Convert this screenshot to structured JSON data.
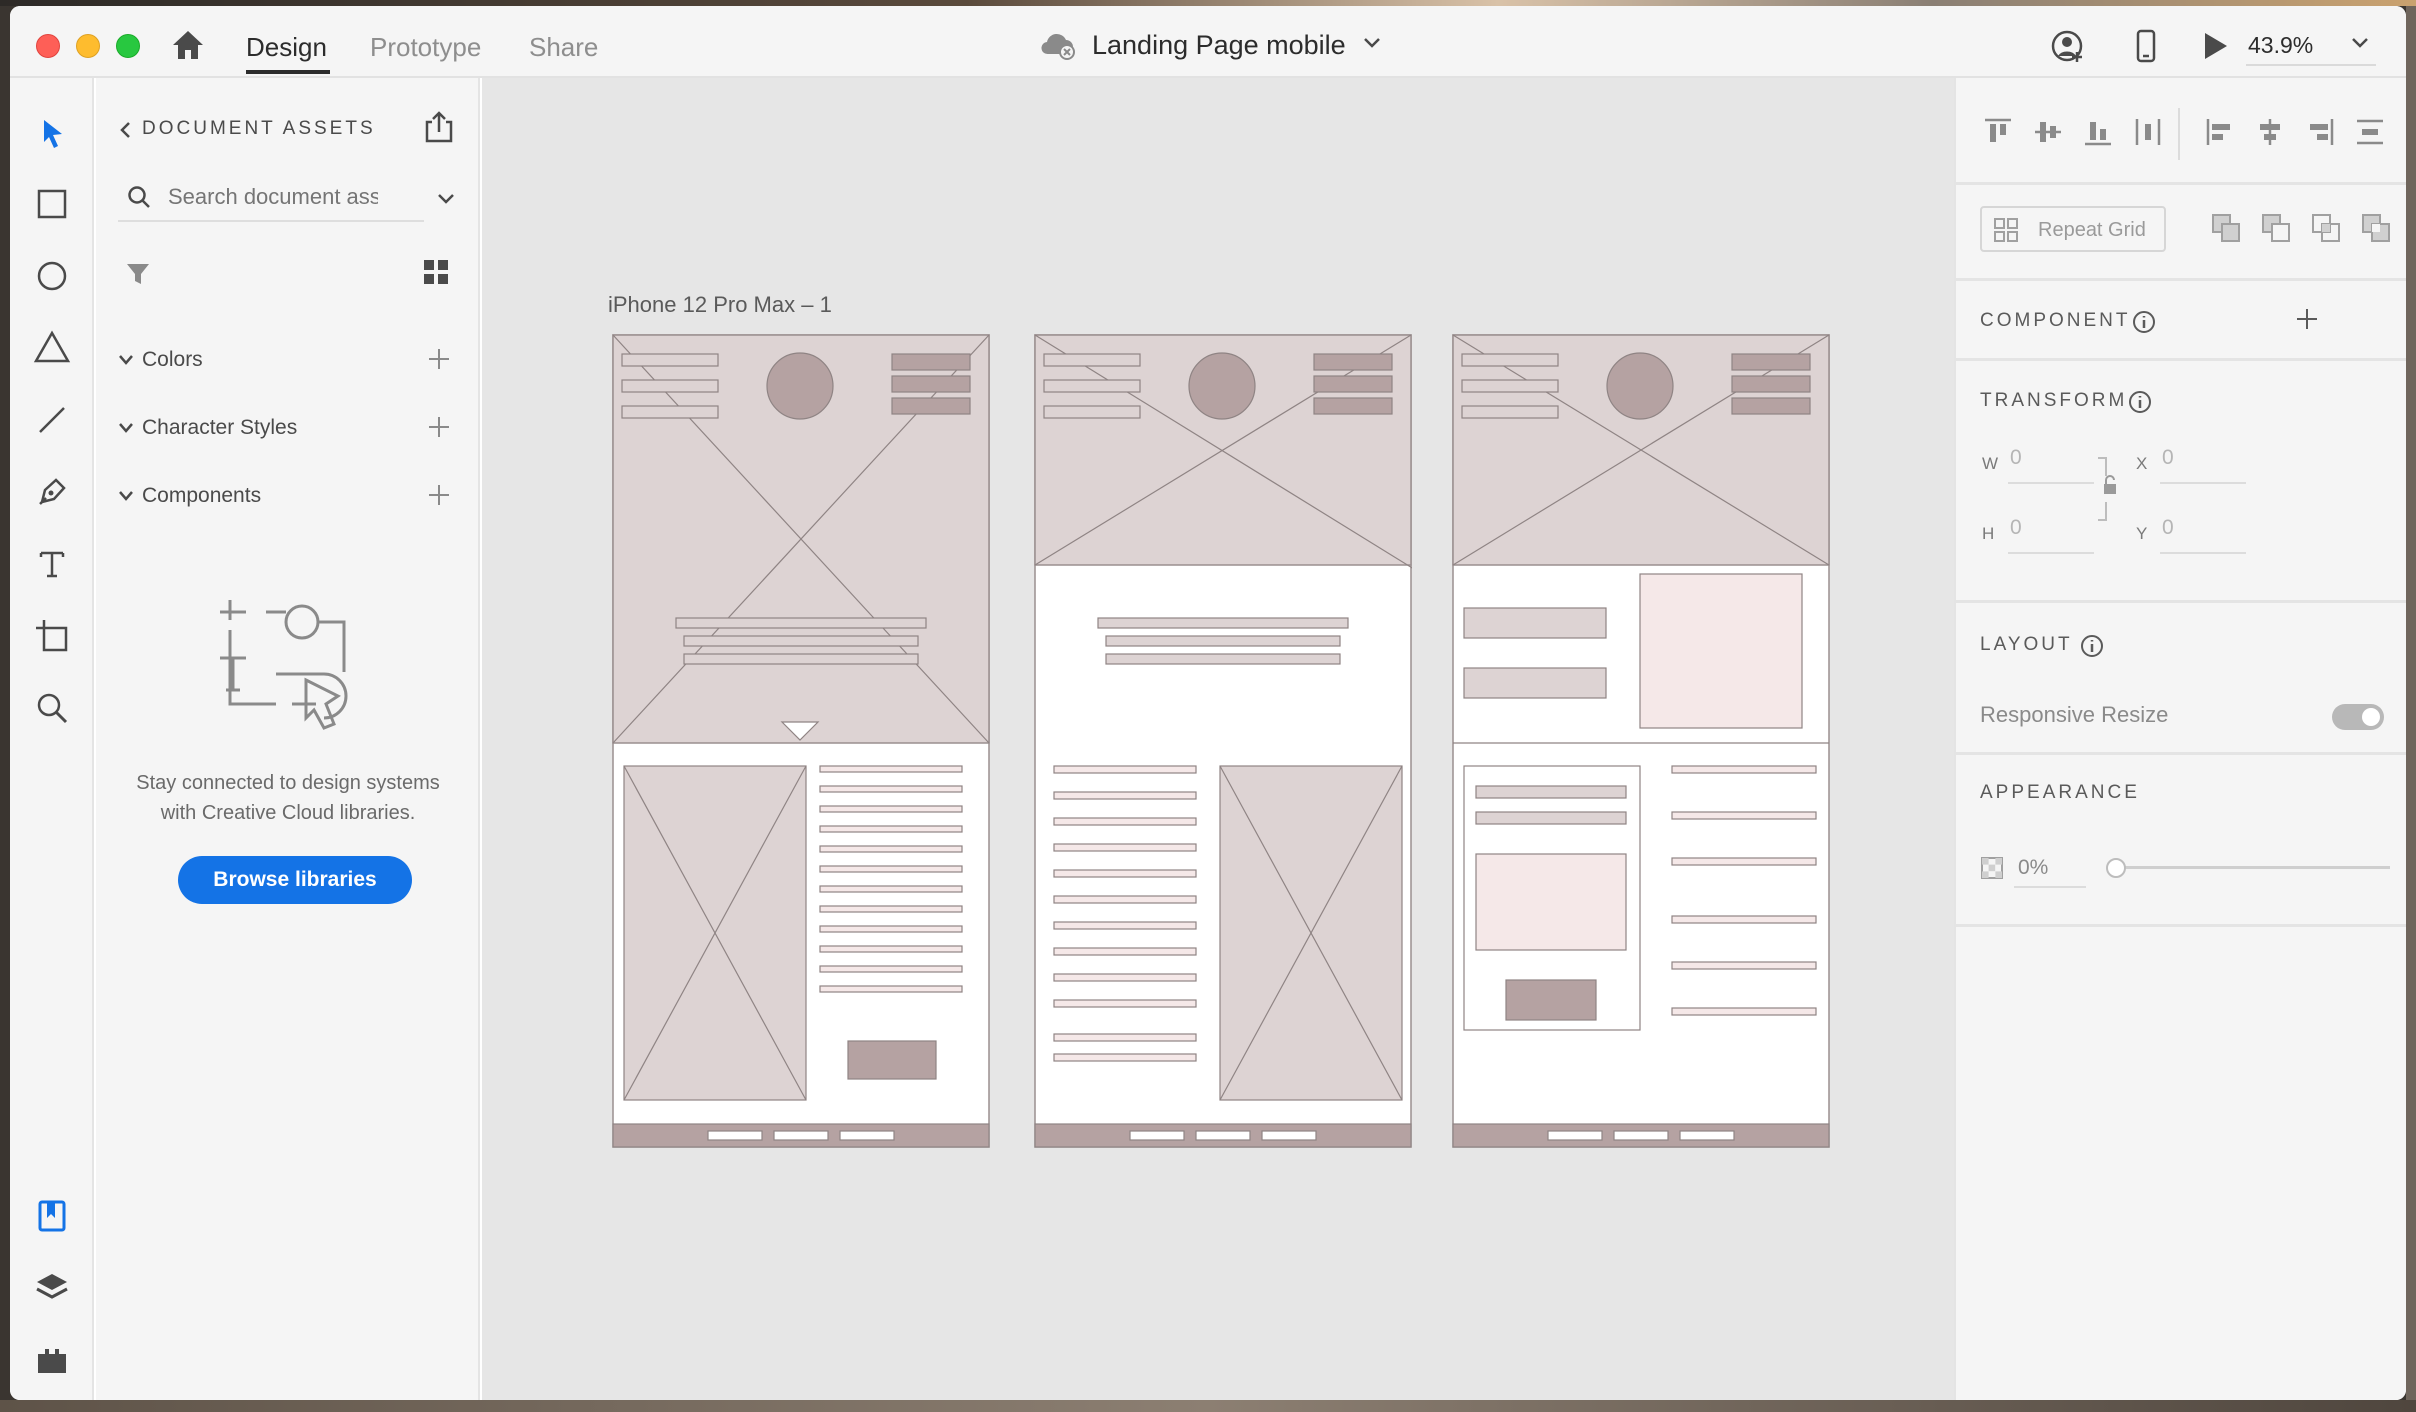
{
  "titlebar": {
    "tabs": [
      "Design",
      "Prototype",
      "Share"
    ],
    "active_tab": "Design",
    "document_title": "Landing Page mobile",
    "zoom": "43.9%"
  },
  "assets": {
    "title": "DOCUMENT ASSETS",
    "search_placeholder": "Search document assets",
    "sections": [
      "Colors",
      "Character Styles",
      "Components"
    ],
    "promo_line1": "Stay connected to design systems",
    "promo_line2": "with Creative Cloud libraries.",
    "browse_label": "Browse libraries"
  },
  "canvas": {
    "artboard_label": "iPhone 12 Pro Max – 1"
  },
  "props": {
    "repeat_grid_label": "Repeat Grid",
    "component_title": "COMPONENT",
    "transform_title": "TRANSFORM",
    "w_label": "W",
    "w_value": "0",
    "h_label": "H",
    "h_value": "0",
    "x_label": "X",
    "x_value": "0",
    "y_label": "Y",
    "y_value": "0",
    "layout_title": "LAYOUT",
    "responsive_resize_label": "Responsive Resize",
    "responsive_resize_on": false,
    "appearance_title": "APPEARANCE",
    "opacity": "0%"
  },
  "colors": {
    "accent": "#1473e6",
    "wireframe_fill": "#ddd3d3",
    "wireframe_dark": "#b5a2a2",
    "wireframe_light": "#f5e8e8"
  },
  "icons": {
    "toolrail": [
      "select-icon",
      "rectangle-icon",
      "ellipse-icon",
      "polygon-icon",
      "line-icon",
      "pen-icon",
      "text-icon",
      "artboard-icon",
      "zoom-icon"
    ],
    "toolrail_bottom": [
      "assets-icon",
      "layers-icon",
      "plugins-icon"
    ]
  }
}
